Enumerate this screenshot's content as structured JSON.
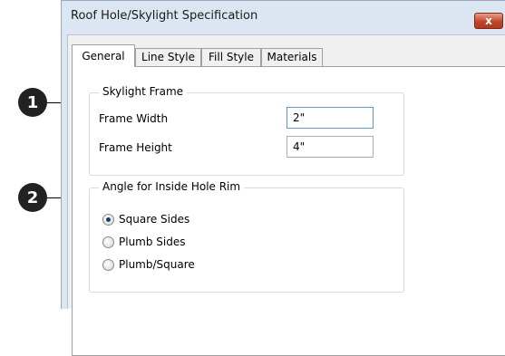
{
  "window": {
    "title": "Roof Hole/Skylight Specification",
    "close_glyph": "x"
  },
  "tabs": [
    {
      "label": "General",
      "active": true
    },
    {
      "label": "Line Style",
      "active": false
    },
    {
      "label": "Fill Style",
      "active": false
    },
    {
      "label": "Materials",
      "active": false
    }
  ],
  "skylight_frame": {
    "legend": "Skylight Frame",
    "frame_width_label": "Frame Width",
    "frame_width_value": "2\"",
    "frame_height_label": "Frame Height",
    "frame_height_value": "4\""
  },
  "angle_group": {
    "legend": "Angle for Inside Hole Rim",
    "options": [
      {
        "label": "Square Sides",
        "selected": true
      },
      {
        "label": "Plumb Sides",
        "selected": false
      },
      {
        "label": "Plumb/Square",
        "selected": false
      }
    ]
  },
  "callouts": [
    "1",
    "2"
  ]
}
